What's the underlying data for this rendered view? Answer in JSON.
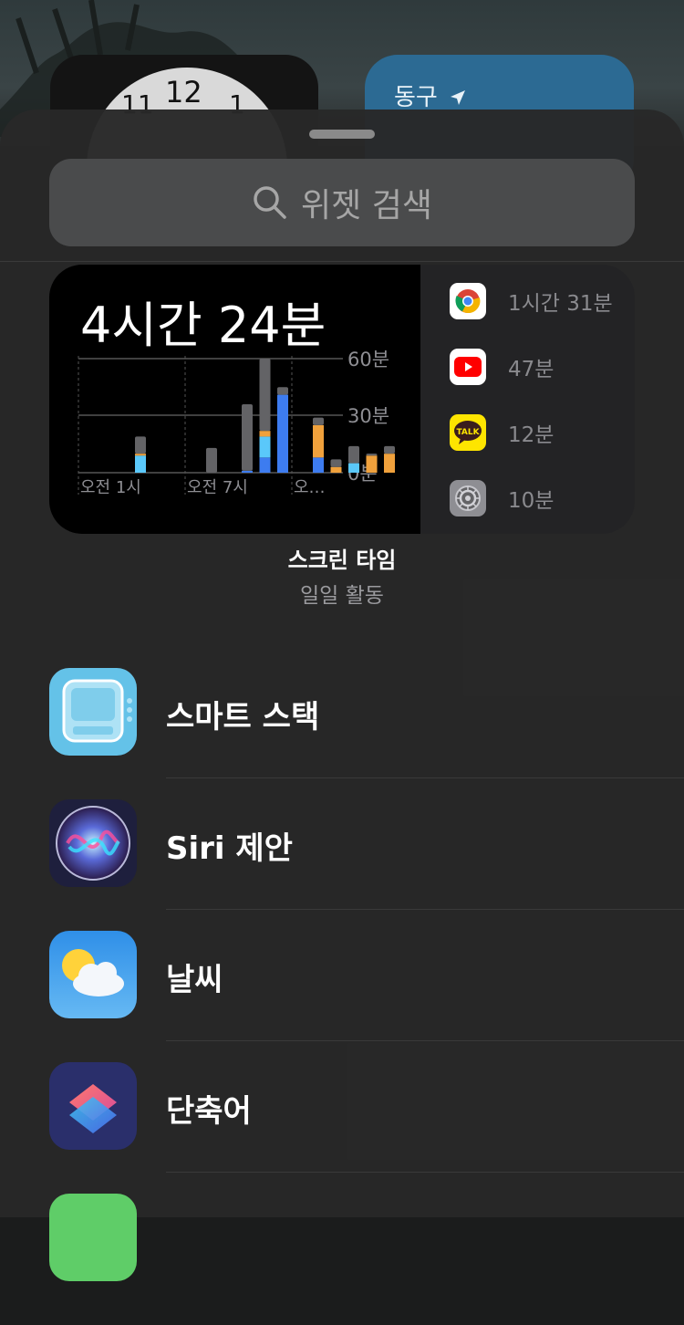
{
  "home": {
    "clock": {
      "n12": "12",
      "n11": "11",
      "n1": "1"
    },
    "weather_location": "동구"
  },
  "search": {
    "placeholder": "위젯 검색",
    "icon": "search-icon"
  },
  "widget": {
    "total": "4시간 24분",
    "axis": {
      "y60": "60분",
      "y30": "30분",
      "y0": "0분",
      "x1": "오전 1시",
      "x2": "오전 7시",
      "x3": "오…"
    },
    "apps": [
      {
        "name": "chrome",
        "icon": "chrome-icon",
        "time": "1시간 31분"
      },
      {
        "name": "youtube",
        "icon": "youtube-icon",
        "time": "47분"
      },
      {
        "name": "kakaotalk",
        "icon": "kakaotalk-icon",
        "icon_text": "TALK",
        "time": "12분"
      },
      {
        "name": "settings",
        "icon": "settings-icon",
        "time": "10분"
      }
    ]
  },
  "chart_data": {
    "type": "bar",
    "ylim": [
      0,
      60
    ],
    "xlabels": [
      "오전 1시",
      "오전 7시",
      "오…"
    ],
    "slots": [
      0,
      1,
      2,
      3,
      4,
      5,
      6,
      7,
      8,
      9,
      10,
      11,
      12,
      13,
      14,
      15,
      16,
      17
    ],
    "series": [
      {
        "color": "#3d7cf0",
        "values": [
          0,
          0,
          0,
          0,
          0,
          0,
          0,
          0,
          1,
          8,
          41,
          0,
          8,
          0,
          0,
          0,
          0,
          0
        ]
      },
      {
        "color": "#5ac8fa",
        "values": [
          0,
          0,
          9,
          0,
          0,
          0,
          0,
          0,
          0,
          11,
          0,
          0,
          0,
          0,
          5,
          0,
          0,
          0
        ]
      },
      {
        "color": "#f0a13c",
        "values": [
          0,
          0,
          1,
          0,
          0,
          0,
          0,
          0,
          0,
          3,
          0,
          0,
          17,
          3,
          0,
          9,
          10,
          0
        ]
      },
      {
        "color": "#636366",
        "values": [
          0,
          0,
          9,
          0,
          0,
          0,
          13,
          0,
          35,
          38,
          4,
          0,
          4,
          4,
          9,
          1,
          4,
          0
        ]
      }
    ]
  },
  "caption": {
    "title": "스크린 타임",
    "subtitle": "일일 활동"
  },
  "list": [
    {
      "label": "스마트 스택",
      "icon": "smart-stack-icon"
    },
    {
      "label": "Siri 제안",
      "icon": "siri-icon"
    },
    {
      "label": "날씨",
      "icon": "weather-icon"
    },
    {
      "label": "단축어",
      "icon": "shortcuts-icon"
    }
  ]
}
